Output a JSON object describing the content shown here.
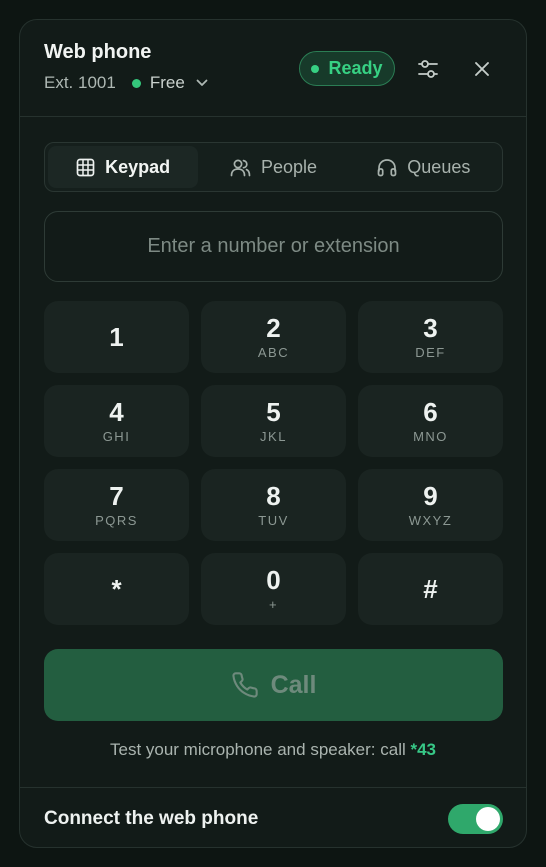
{
  "header": {
    "title": "Web phone",
    "extension": "Ext. 1001",
    "availability": "Free",
    "status": "Ready"
  },
  "tabs": [
    {
      "label": "Keypad",
      "icon": "grid-icon",
      "active": true
    },
    {
      "label": "People",
      "icon": "people-icon",
      "active": false
    },
    {
      "label": "Queues",
      "icon": "headset-icon",
      "active": false
    }
  ],
  "dial_input": {
    "value": "",
    "placeholder": "Enter a number or extension"
  },
  "keypad": [
    {
      "digit": "1",
      "letters": ""
    },
    {
      "digit": "2",
      "letters": "ABC"
    },
    {
      "digit": "3",
      "letters": "DEF"
    },
    {
      "digit": "4",
      "letters": "GHI"
    },
    {
      "digit": "5",
      "letters": "JKL"
    },
    {
      "digit": "6",
      "letters": "MNO"
    },
    {
      "digit": "7",
      "letters": "PQRS"
    },
    {
      "digit": "8",
      "letters": "TUV"
    },
    {
      "digit": "9",
      "letters": "WXYZ"
    },
    {
      "digit": "*",
      "letters": ""
    },
    {
      "digit": "0",
      "letters": "+"
    },
    {
      "digit": "#",
      "letters": ""
    }
  ],
  "call_button": {
    "label": "Call",
    "icon": "phone-icon"
  },
  "hint": {
    "text": "Test your microphone and speaker: call ",
    "code": "*43"
  },
  "footer": {
    "label": "Connect the web phone",
    "connected": true
  },
  "colors": {
    "accent": "#37d083",
    "call_bg": "#235e40",
    "panel_bg": "#121b18"
  }
}
